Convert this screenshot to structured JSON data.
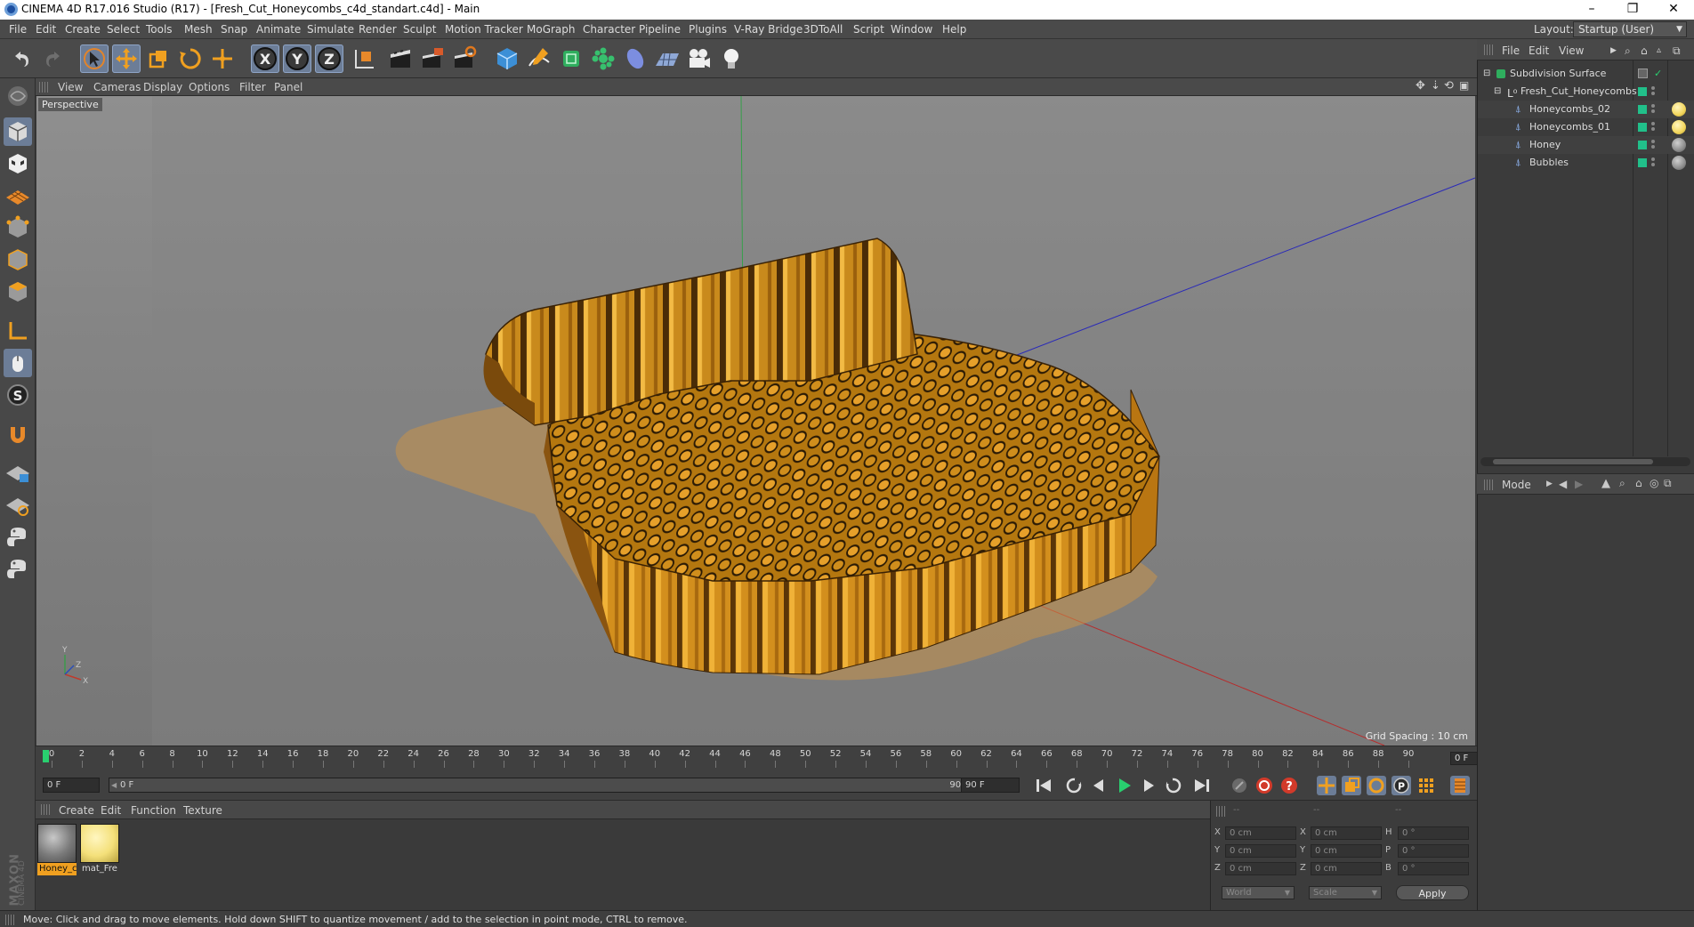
{
  "window": {
    "title": "CINEMA 4D R17.016 Studio (R17) - [Fresh_Cut_Honeycombs_c4d_standart.c4d] - Main",
    "controls": [
      "–",
      "❐",
      "✕"
    ]
  },
  "menubar": {
    "items": [
      "File",
      "Edit",
      "Create",
      "Select",
      "Tools",
      "Mesh",
      "Snap",
      "Animate",
      "Simulate",
      "Render",
      "Sculpt",
      "Motion Tracker",
      "MoGraph",
      "Character",
      "Pipeline",
      "Plugins",
      "V-Ray Bridge",
      "3DToAll",
      "Script",
      "Window",
      "Help"
    ],
    "layout_label": "Layout:",
    "layout_value": "Startup (User)"
  },
  "toolbar": {
    "tools": [
      "undo-icon",
      "redo-icon",
      "live-selection-icon",
      "move-icon",
      "scale-icon",
      "rotate-icon",
      "transform-icon",
      "x-axis-icon",
      "y-axis-icon",
      "z-axis-icon",
      "coordinate-system-icon",
      "render-view-icon",
      "render-picture-viewer-icon",
      "edit-render-settings-icon",
      "cube-icon",
      "pen-spline-icon",
      "subdivision-icon",
      "cloner-icon",
      "deformer-icon",
      "floor-icon",
      "camera-icon",
      "light-icon"
    ],
    "axis_letters": [
      "X",
      "Y",
      "Z"
    ]
  },
  "viewport": {
    "menu": [
      "View",
      "Cameras",
      "Display",
      "Options",
      "Filter",
      "Panel"
    ],
    "camera_label": "Perspective",
    "grid_spacing": "Grid Spacing : 10 cm",
    "axis_labels": {
      "x": "X",
      "y": "Y",
      "z": "Z"
    }
  },
  "timeline": {
    "ticks": [
      "0",
      "2",
      "4",
      "6",
      "8",
      "10",
      "12",
      "14",
      "16",
      "18",
      "20",
      "22",
      "24",
      "26",
      "28",
      "30",
      "32",
      "34",
      "36",
      "38",
      "40",
      "42",
      "44",
      "46",
      "48",
      "50",
      "52",
      "54",
      "56",
      "58",
      "60",
      "62",
      "64",
      "66",
      "68",
      "70",
      "72",
      "74",
      "76",
      "78",
      "80",
      "82",
      "84",
      "86",
      "88",
      "90"
    ],
    "end_frame_display": "0 F"
  },
  "transport": {
    "current_frame": "0 F",
    "range_start": "0 F",
    "range_end": "90 F",
    "max_frame": "90 F"
  },
  "materials": {
    "menu": [
      "Create",
      "Edit",
      "Function",
      "Texture"
    ],
    "items": [
      {
        "label": "Honey_c",
        "color": "#8c8c8c",
        "selected": true
      },
      {
        "label": "mat_Fre",
        "color": "#f4e07a",
        "selected": false
      }
    ]
  },
  "coordinates": {
    "headers": [
      "--",
      "--",
      "--"
    ],
    "rows": [
      {
        "axis": "X",
        "pos": "0 cm",
        "size_axis": "X",
        "size": "0 cm",
        "rot_axis": "H",
        "rot": "0 °"
      },
      {
        "axis": "Y",
        "pos": "0 cm",
        "size_axis": "Y",
        "size": "0 cm",
        "rot_axis": "P",
        "rot": "0 °"
      },
      {
        "axis": "Z",
        "pos": "0 cm",
        "size_axis": "Z",
        "size": "0 cm",
        "rot_axis": "B",
        "rot": "0 °"
      }
    ],
    "mode_select": "World",
    "size_select": "Scale",
    "apply_label": "Apply"
  },
  "object_manager": {
    "menu": [
      "File",
      "Edit",
      "View"
    ],
    "objects": [
      {
        "name": "Subdivision Surface",
        "indent": 0,
        "icon": "subdivision-icon",
        "tag": ""
      },
      {
        "name": "Fresh_Cut_Honeycombs",
        "indent": 1,
        "icon": "null-object-icon",
        "tag": ""
      },
      {
        "name": "Honeycombs_02",
        "indent": 2,
        "icon": "polygon-object-icon",
        "tag": "#f2d55a"
      },
      {
        "name": "Honeycombs_01",
        "indent": 2,
        "icon": "polygon-object-icon",
        "tag": "#f2d55a"
      },
      {
        "name": "Honey",
        "indent": 2,
        "icon": "polygon-object-icon",
        "tag": "#8d8d8d"
      },
      {
        "name": "Bubbles",
        "indent": 2,
        "icon": "polygon-object-icon",
        "tag": "#8d8d8d"
      }
    ]
  },
  "attribute_manager": {
    "menu_label": "Mode"
  },
  "brand": {
    "line1": "MAXON",
    "line2": "CINEMA 4D"
  },
  "status": {
    "text": "Move: Click and drag to move elements. Hold down SHIFT to quantize movement / add to the selection in point mode, CTRL to remove."
  }
}
